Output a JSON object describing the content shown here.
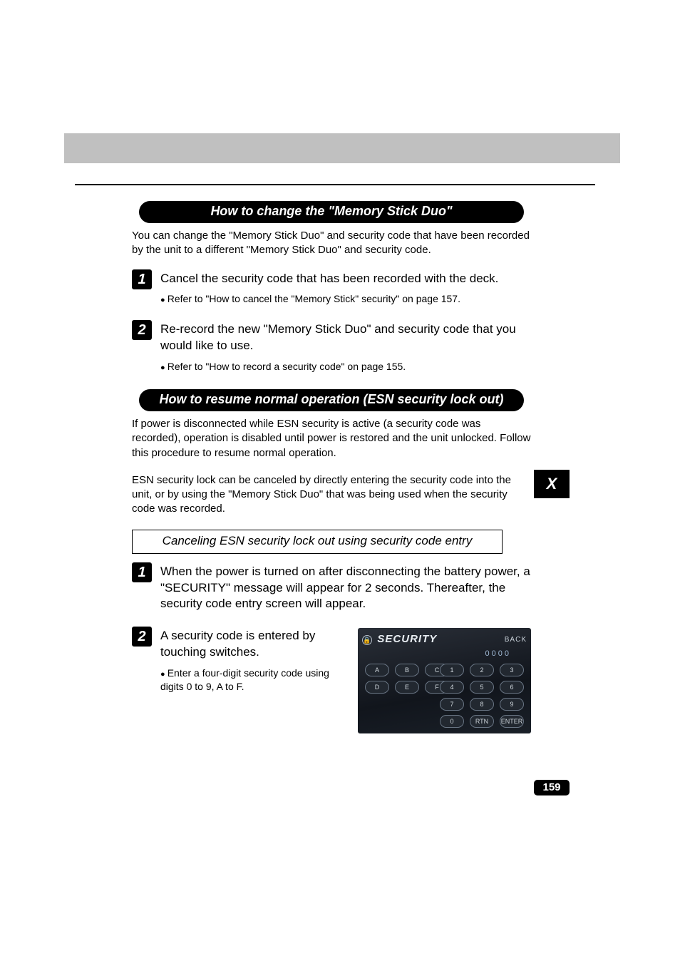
{
  "section1": {
    "title": "How to change the \"Memory Stick Duo\"",
    "intro": "You can change the \"Memory Stick Duo\" and security code that have been recorded by the unit to a different \"Memory Stick Duo\" and security code.",
    "steps": [
      {
        "num": "1",
        "title": "Cancel the security code that has been recorded with the deck.",
        "sub": "Refer to \"How to cancel the \"Memory Stick\" security\" on page 157."
      },
      {
        "num": "2",
        "title": "Re-record the new \"Memory Stick Duo\" and security code that you would like to use.",
        "sub": "Refer to \"How to record a security code\" on page 155."
      }
    ]
  },
  "section2": {
    "title": "How to resume normal operation (ESN security lock out)",
    "para1": "If power is disconnected while ESN security is active (a security code was recorded), operation is disabled until power is restored and the unit unlocked. Follow this procedure to resume normal operation.",
    "para2": "ESN security lock can be canceled by directly entering the security code into the unit, or by using the \"Memory Stick Duo\" that was being used when the security code was recorded.",
    "subheading": "Canceling ESN security lock out using security code entry",
    "steps": [
      {
        "num": "1",
        "title": "When the power is turned on after disconnecting the battery power, a \"SECURITY\" message will appear for 2 seconds. Thereafter, the security code entry screen will appear."
      },
      {
        "num": "2",
        "title": "A security code is entered by touching switches.",
        "sub": "Enter a four-digit security code using digits 0 to 9, A to F."
      }
    ]
  },
  "device": {
    "title": "SECURITY",
    "back": "BACK",
    "code": "0000",
    "hex": [
      "A",
      "B",
      "C",
      "D",
      "E",
      "F"
    ],
    "num": [
      "1",
      "2",
      "3",
      "4",
      "5",
      "6",
      "7",
      "8",
      "9",
      "0",
      "RTN",
      "ENTER"
    ]
  },
  "tab": "X",
  "page": "159"
}
